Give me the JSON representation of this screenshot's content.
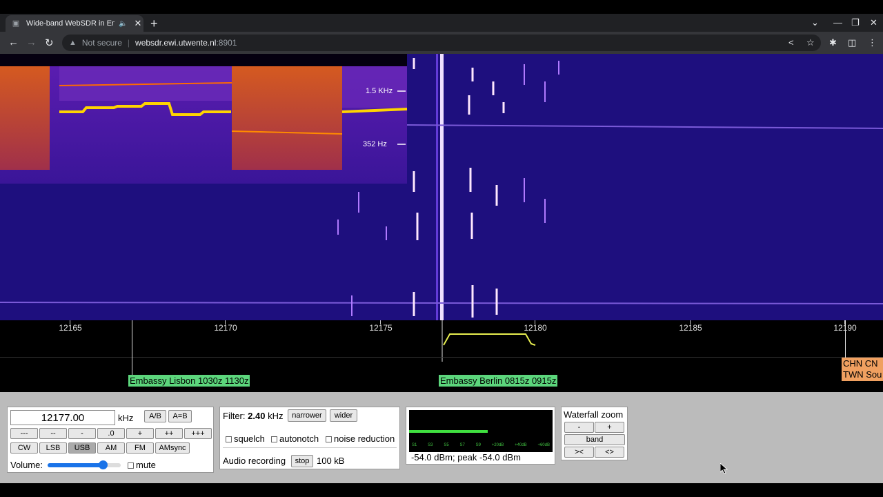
{
  "browser": {
    "tab_title": "Wide-band WebSDR in Ensch",
    "url_host": "websdr.ewi.utwente.nl",
    "url_port": ":8901",
    "not_secure": "Not secure"
  },
  "waterfall": {
    "marker_1": "1.5  KHz",
    "marker_2": "352  Hz"
  },
  "scale": {
    "ticks": [
      "12165",
      "12170",
      "12175",
      "12180",
      "12185",
      "12190"
    ],
    "stations": [
      {
        "label": "Embassy Lisbon 1030z 1130z"
      },
      {
        "label": "Embassy Berlin 0815z 0915z"
      },
      {
        "label_line1": "CHN CN",
        "label_line2": "TWN Sou"
      }
    ]
  },
  "freq": {
    "value": "12177.00",
    "unit": "kHz",
    "ab": "A/B",
    "aeqb": "A=B",
    "steps": [
      "---",
      "--",
      "-",
      ".0",
      "+",
      "++",
      "+++"
    ],
    "modes": [
      "CW",
      "LSB",
      "USB",
      "AM",
      "FM",
      "AMsync"
    ],
    "active_mode": "USB",
    "volume_label": "Volume:",
    "volume_level": 0.75,
    "mute_label": "mute"
  },
  "filter": {
    "label": "Filter:",
    "value": "2.40",
    "unit": "kHz",
    "narrower": "narrower",
    "wider": "wider",
    "squelch": "squelch",
    "autonotch": "autonotch",
    "noise_reduction": "noise reduction",
    "audio_recording": "Audio recording",
    "stop": "stop",
    "size": "100 kB"
  },
  "smeter": {
    "scale": [
      "S1",
      "S3",
      "S5",
      "S7",
      "S9",
      "+20dB",
      "+40dB",
      "+60dB"
    ],
    "level": 0.55,
    "reading": "-54.0 dBm; peak  -54.0 dBm"
  },
  "zoom": {
    "title": "Waterfall zoom",
    "minus": "-",
    "plus": "+",
    "band": "band",
    "shrink": "><",
    "expand": "<>"
  }
}
